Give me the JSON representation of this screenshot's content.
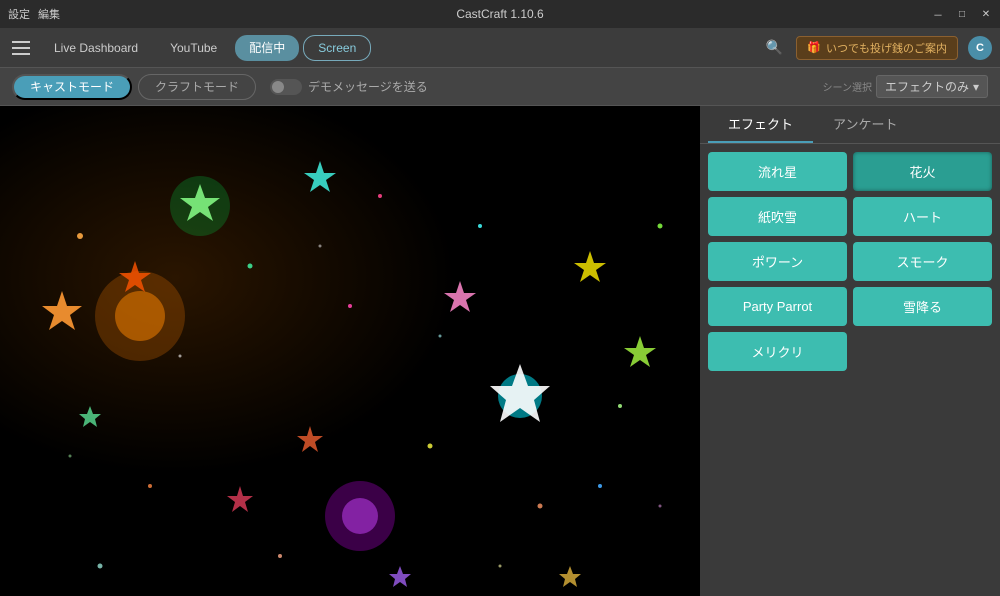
{
  "titlebar": {
    "menu1": "設定",
    "menu2": "編集",
    "title": "CastCraft 1.10.6",
    "btn_minimize": "－",
    "btn_maximize": "□",
    "btn_close": "✕"
  },
  "navbar": {
    "tab_live": "Live Dashboard",
    "tab_youtube": "YouTube",
    "tab_recording": "配信中",
    "tab_screen": "Screen",
    "promo_icon": "🎁",
    "promo_text": "いつでも投げ銭のご案内",
    "logo": "C"
  },
  "modebar": {
    "cast_mode": "キャストモード",
    "craft_mode": "クラフトモード",
    "demo_label": "デモメッセージを送る",
    "scene_label": "シーン選択",
    "scene_value": "エフェクトのみ"
  },
  "effectpanel": {
    "tab_effect": "エフェクト",
    "tab_anketo": "アンケート",
    "effects": [
      {
        "id": "ryuusei",
        "label": "流れ星",
        "active": false
      },
      {
        "id": "hanabi",
        "label": "花火",
        "active": true
      },
      {
        "id": "kamifubuki",
        "label": "紙吹雪",
        "active": false
      },
      {
        "id": "heart",
        "label": "ハート",
        "active": false
      },
      {
        "id": "bounce",
        "label": "ポワーン",
        "active": false
      },
      {
        "id": "smoke",
        "label": "スモーク",
        "active": false
      },
      {
        "id": "parrot",
        "label": "Party Parrot",
        "active": false
      },
      {
        "id": "yukifuru",
        "label": "雪降る",
        "active": false
      },
      {
        "id": "merikuri",
        "label": "メリクリ",
        "active": false
      }
    ]
  }
}
